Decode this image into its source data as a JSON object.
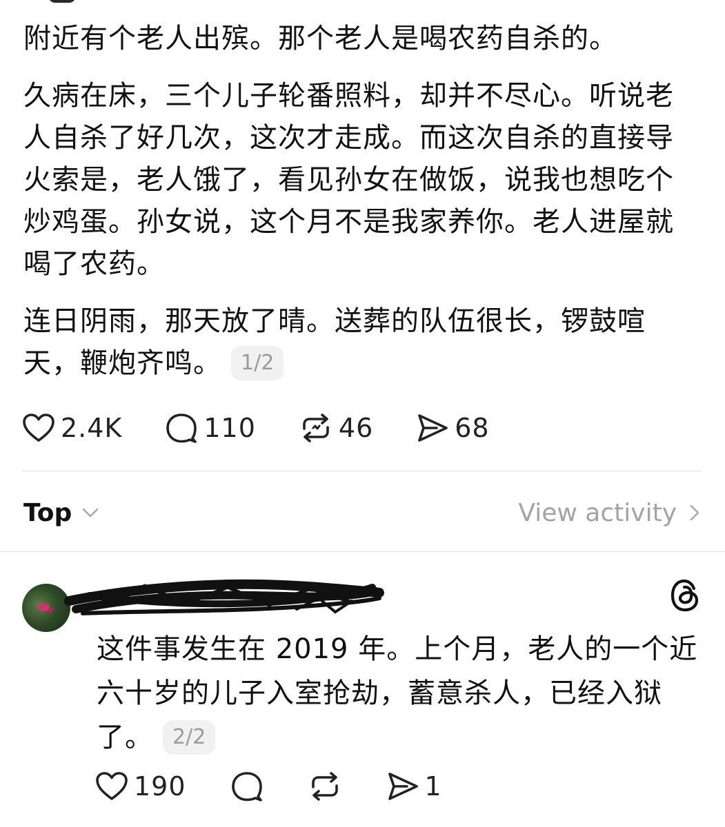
{
  "post": {
    "paragraphs": [
      "附近有个老人出殡。那个老人是喝农药自杀的。",
      "久病在床，三个儿子轮番照料，却并不尽心。听说老人自杀了好几次，这次才走成。而这次自杀的直接导火索是，老人饿了，看见孙女在做饭，说我也想吃个炒鸡蛋。孙女说，这个月不是我家养你。老人进屋就喝了农药。",
      "连日阴雨，那天放了晴。送葬的队伍很长，锣鼓喧天，鞭炮齐鸣。"
    ],
    "page_indicator": "1/2",
    "stats": {
      "likes": "2.4K",
      "replies": "110",
      "reposts": "46",
      "shares": "68"
    }
  },
  "sort": {
    "label": "Top",
    "view_activity": "View activity"
  },
  "reply": {
    "text": "这件事发生在 2019 年。上个月，老人的一个近六十岁的儿子入室抢劫，蓄意杀人，已经入狱了。",
    "page_indicator": "2/2",
    "stats": {
      "likes": "190",
      "shares": "1"
    }
  },
  "icons": {
    "like": "heart-icon",
    "reply": "comment-bubble-icon",
    "repost": "repost-icon",
    "share": "send-icon",
    "sort": "chevron-down-icon",
    "activity": "chevron-right-icon",
    "brand": "threads-logo-icon"
  },
  "colors": {
    "text": "#111111",
    "muted": "#a3a3a3",
    "chip_bg": "#f1f1f1",
    "divider": "#e3e3e3"
  }
}
